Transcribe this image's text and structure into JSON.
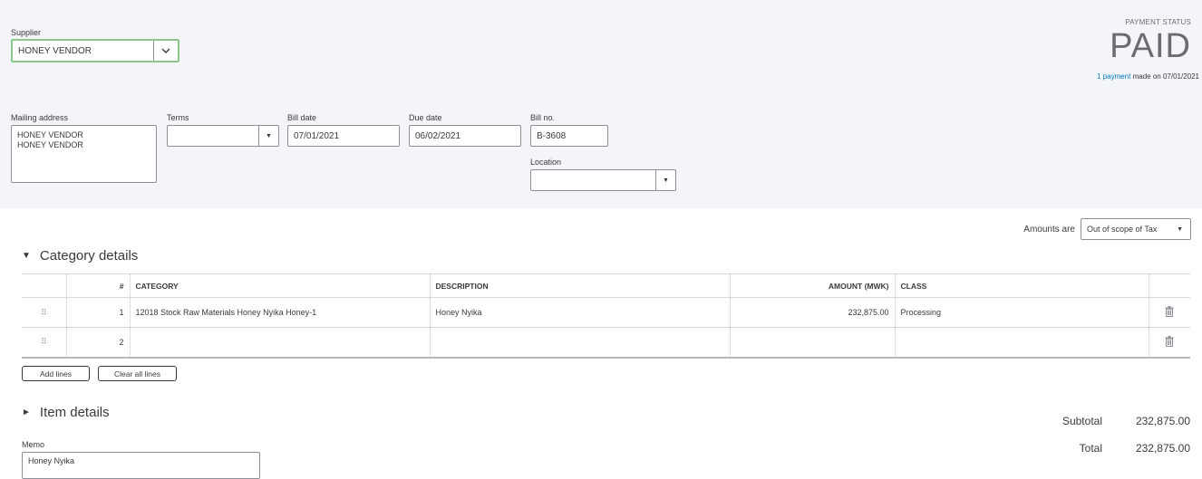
{
  "header": {
    "supplier_label": "Supplier",
    "supplier_value": "HONEY VENDOR",
    "payment_status_label": "PAYMENT STATUS",
    "payment_status": "PAID",
    "payment_link": "1 payment",
    "payment_made_text": "made on 07/01/2021"
  },
  "form": {
    "mailing_address_label": "Mailing address",
    "mailing_address_line1": "HONEY VENDOR",
    "mailing_address_line2": "HONEY VENDOR",
    "terms_label": "Terms",
    "terms_value": "",
    "bill_date_label": "Bill date",
    "bill_date": "07/01/2021",
    "due_date_label": "Due date",
    "due_date": "06/02/2021",
    "bill_no_label": "Bill no.",
    "bill_no": "B-3608",
    "location_label": "Location",
    "location_value": ""
  },
  "amounts": {
    "label": "Amounts are",
    "value": "Out of scope of Tax"
  },
  "category": {
    "title": "Category details",
    "columns": [
      "#",
      "CATEGORY",
      "DESCRIPTION",
      "AMOUNT (MWK)",
      "CLASS"
    ],
    "rows": [
      {
        "num": "1",
        "category": "12018 Stock Raw Materials Honey Nyika Honey-1",
        "description": "Honey Nyika",
        "amount": "232,875.00",
        "class": "Processing"
      },
      {
        "num": "2",
        "category": "",
        "description": "",
        "amount": "",
        "class": ""
      }
    ],
    "add_lines": "Add lines",
    "clear_lines": "Clear all lines"
  },
  "items": {
    "title": "Item details"
  },
  "totals": {
    "subtotal_label": "Subtotal",
    "subtotal": "232,875.00",
    "total_label": "Total",
    "total": "232,875.00"
  },
  "memo": {
    "label": "Memo",
    "value": "Honey Nyika"
  }
}
